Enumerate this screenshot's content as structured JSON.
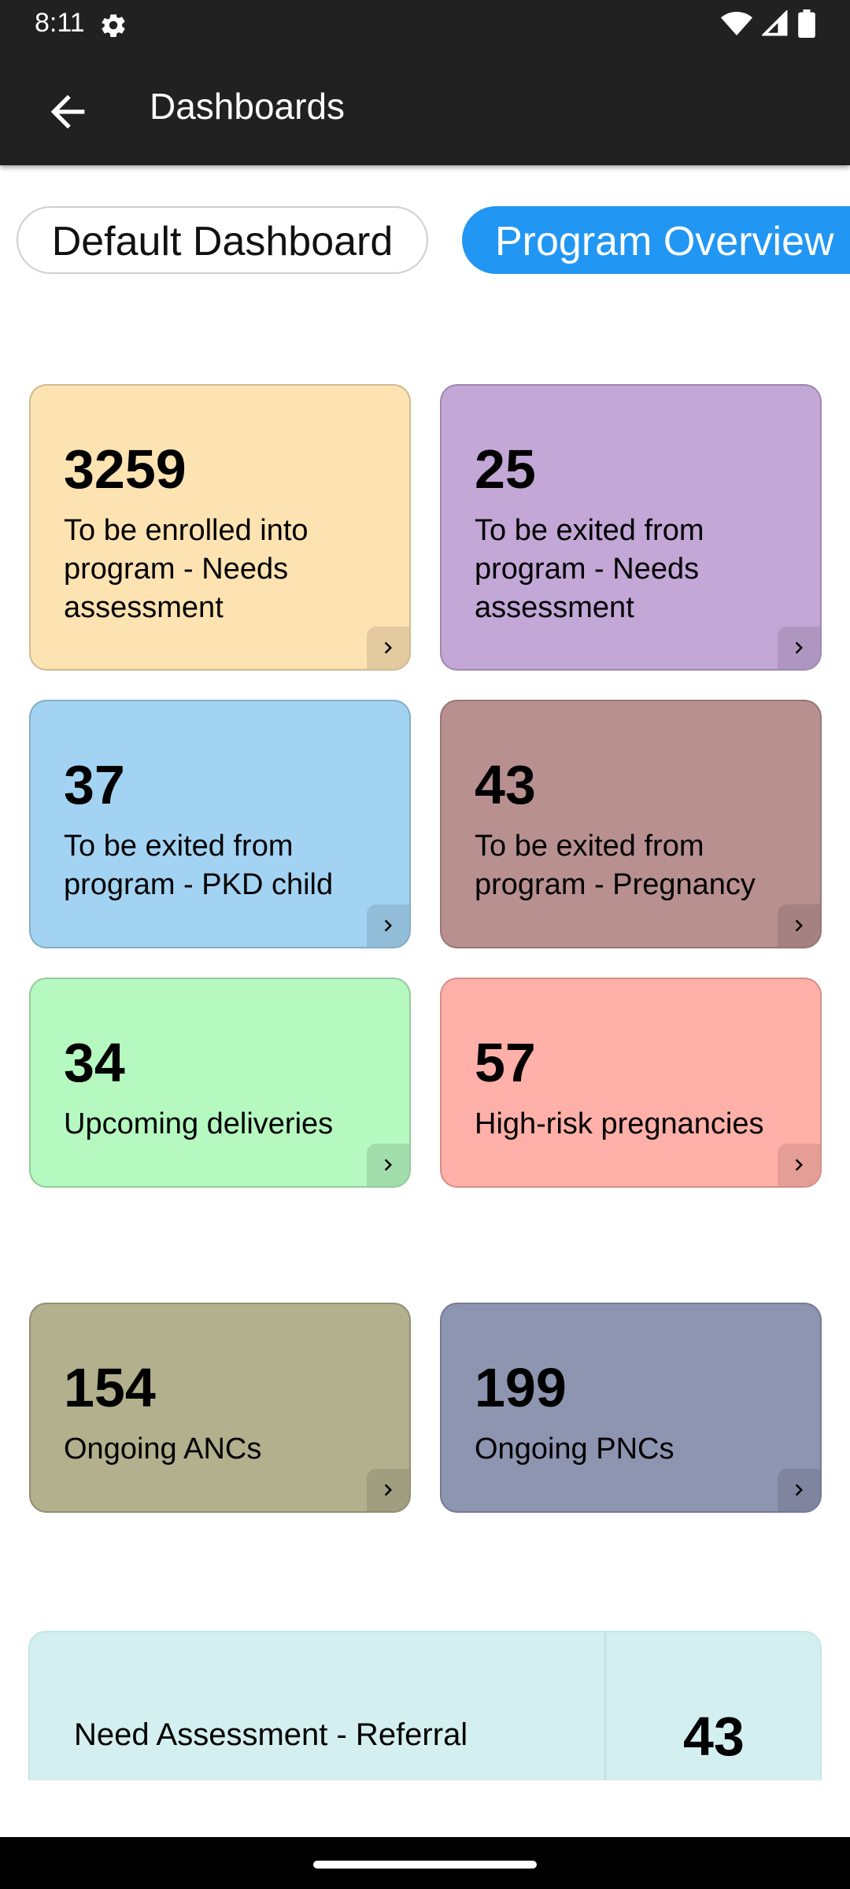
{
  "status_bar": {
    "time": "8:11",
    "icons": [
      "gear-icon",
      "wifi-icon",
      "signal-icon",
      "battery-icon"
    ]
  },
  "app_bar": {
    "title": "Dashboards",
    "back_icon": "arrow-left-icon"
  },
  "tabs": [
    {
      "label": "Default Dashboard",
      "selected": false
    },
    {
      "label": "Program Overview",
      "selected": true
    }
  ],
  "cards": [
    {
      "count": "3259",
      "label": "To be enrolled into program - Needs assessment",
      "color": "#fde3b2"
    },
    {
      "count": "25",
      "label": "To be exited from program - Needs assessment",
      "color": "#c3a7d7"
    },
    {
      "count": "37",
      "label": "To be exited from program - PKD child",
      "color": "#a3d3f2"
    },
    {
      "count": "43",
      "label": "To be exited from program - Pregnancy",
      "color": "#b99090"
    },
    {
      "count": "34",
      "label": "Upcoming deliveries",
      "color": "#b5f8c0"
    },
    {
      "count": "57",
      "label": "High-risk pregnancies",
      "color": "#ffb0a8"
    },
    {
      "count": "154",
      "label": "Ongoing ANCs",
      "color": "#b2b08d"
    },
    {
      "count": "199",
      "label": "Ongoing PNCs",
      "color": "#8e95b1"
    }
  ],
  "referral": {
    "label": "Need Assessment - Referral",
    "count": "43",
    "color": "#d4efef"
  },
  "colors": {
    "app_bar": "#212121",
    "tab_selected": "#2196f3"
  }
}
